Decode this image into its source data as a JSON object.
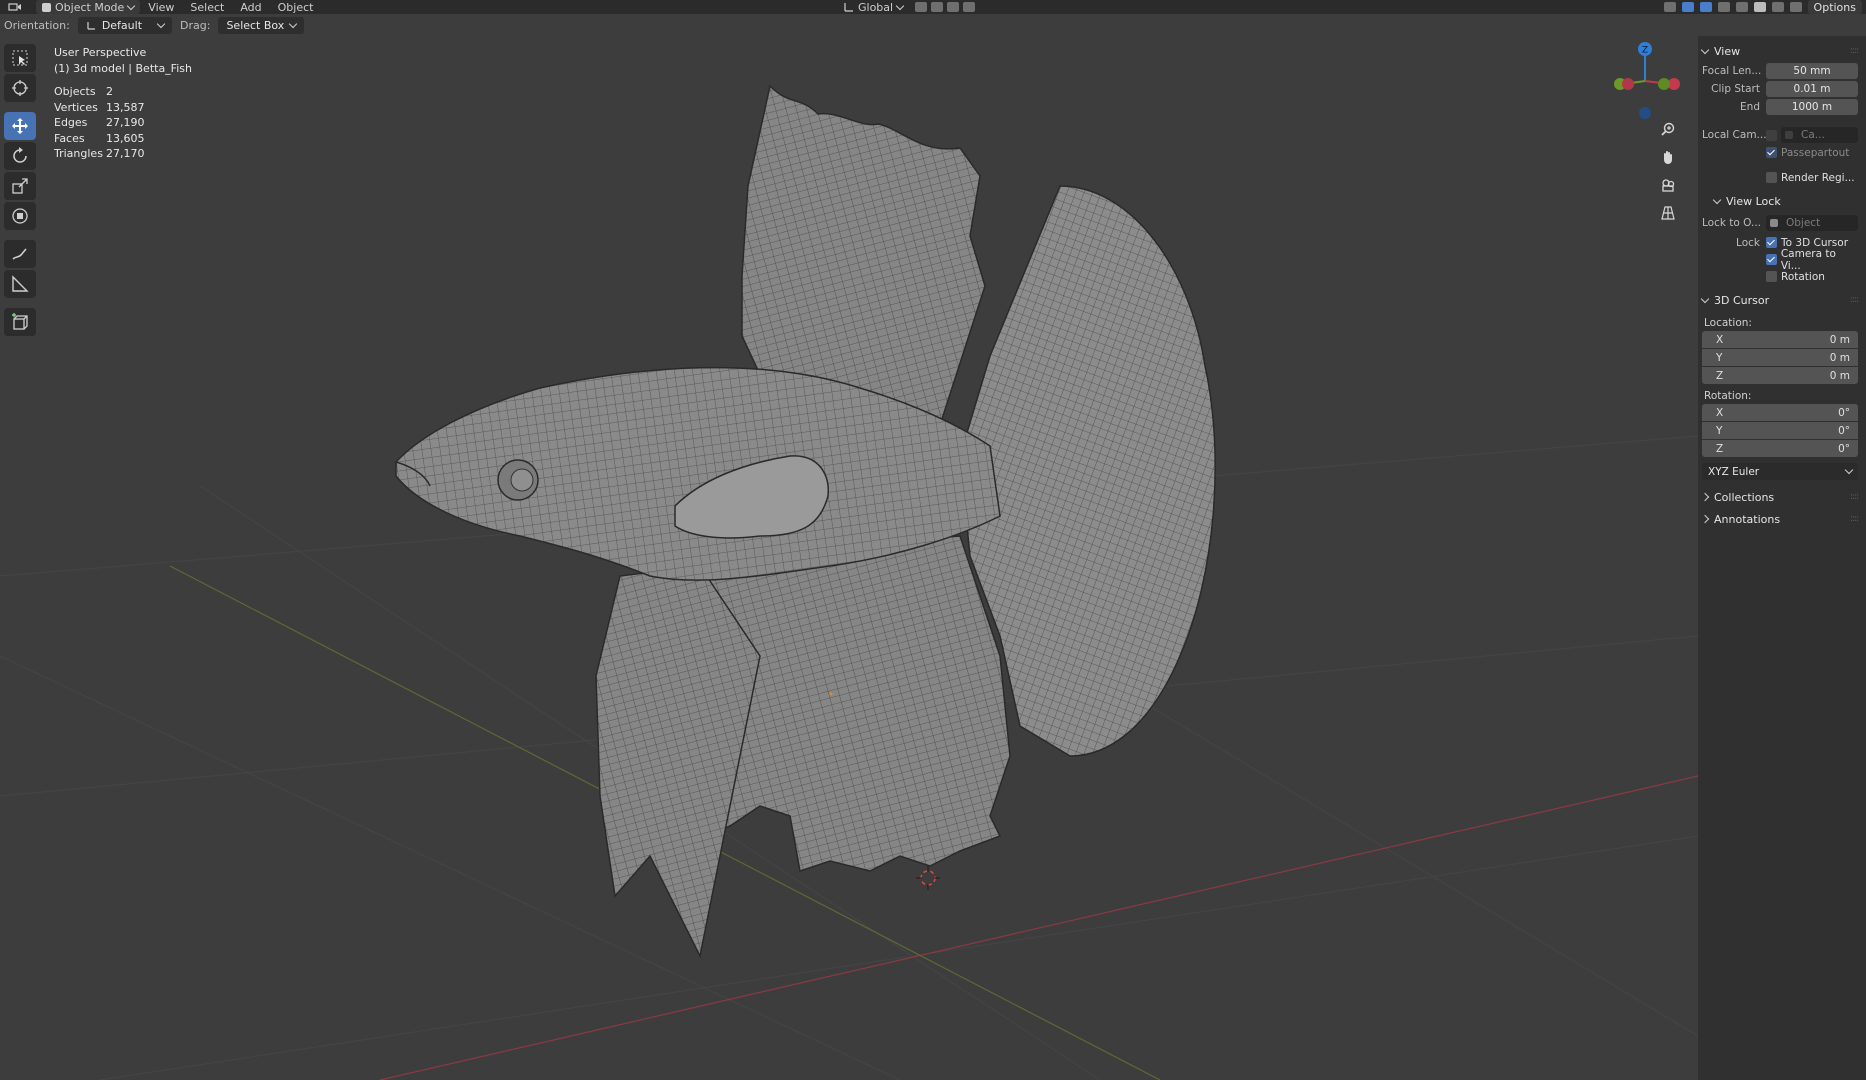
{
  "header": {
    "mode": "Object Mode",
    "menus": [
      "View",
      "Select",
      "Add",
      "Object"
    ],
    "transform_orientation": "Global",
    "options_label": "Options"
  },
  "tool_settings": {
    "orientation_label": "Orientation:",
    "orientation_value": "Default",
    "drag_label": "Drag:",
    "drag_value": "Select Box"
  },
  "viewport": {
    "view_name": "User Perspective",
    "object_line": "(1) 3d model | Betta_Fish",
    "stats": [
      {
        "label": "Objects",
        "value": "2"
      },
      {
        "label": "Vertices",
        "value": "13,587"
      },
      {
        "label": "Edges",
        "value": "27,190"
      },
      {
        "label": "Faces",
        "value": "13,605"
      },
      {
        "label": "Triangles",
        "value": "27,170"
      }
    ],
    "gizmo": {
      "x": "",
      "y": "",
      "z": "Z"
    },
    "colors": {
      "x_axis": "#c6384e",
      "y_axis": "#6c9a26",
      "z_axis": "#2f7fd6",
      "active_tool": "#4772b3"
    }
  },
  "sidebar": {
    "view_panel": {
      "title": "View",
      "focal_length_label": "Focal Len...",
      "focal_length": "50 mm",
      "clip_start_label": "Clip Start",
      "clip_start": "0.01 m",
      "end_label": "End",
      "end": "1000 m",
      "local_camera_label": "Local Cam...",
      "local_camera_value": "Ca...",
      "passepartout": "Passepartout",
      "render_region": "Render Regi..."
    },
    "view_lock": {
      "title": "View Lock",
      "lock_to_object_label": "Lock to O...",
      "lock_to_object_placeholder": "Object",
      "lock_label": "Lock",
      "to_3d_cursor": "To 3D Cursor",
      "camera_to_view": "Camera to Vi...",
      "rotation": "Rotation"
    },
    "cursor_panel": {
      "title": "3D Cursor",
      "location_label": "Location:",
      "location": [
        {
          "axis": "X",
          "value": "0 m"
        },
        {
          "axis": "Y",
          "value": "0 m"
        },
        {
          "axis": "Z",
          "value": "0 m"
        }
      ],
      "rotation_label": "Rotation:",
      "rotation": [
        {
          "axis": "X",
          "value": "0°"
        },
        {
          "axis": "Y",
          "value": "0°"
        },
        {
          "axis": "Z",
          "value": "0°"
        }
      ],
      "rotation_mode": "XYZ Euler"
    },
    "collections": "Collections",
    "annotations": "Annotations"
  }
}
